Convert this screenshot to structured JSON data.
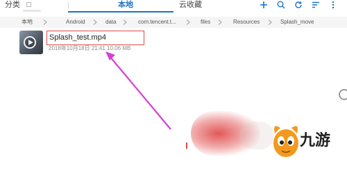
{
  "header": {
    "tab_categories": "分类",
    "tab_local": "本地",
    "tab_cloud": "云收藏",
    "actions": [
      "plus-icon",
      "search-icon",
      "refresh-icon",
      "sort-icon",
      "more-icon"
    ]
  },
  "breadcrumb": {
    "items": [
      "本地",
      "Android",
      "data",
      "com.tencent.t...",
      "files",
      "Resources",
      "Splash_move"
    ]
  },
  "file": {
    "name": "Splash_test.mp4",
    "meta": "2018年10月18日 21:41 10.06 MB"
  },
  "watermark": {
    "text": "九游"
  },
  "colors": {
    "accent": "#1a73c9",
    "highlight_box": "#e04848",
    "arrow": "#d63fd6"
  }
}
